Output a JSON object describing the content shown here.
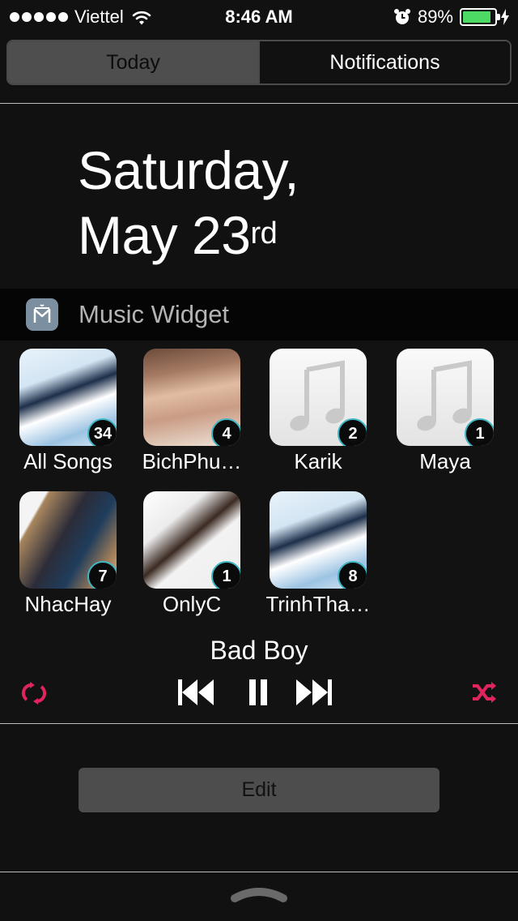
{
  "status_bar": {
    "carrier": "Viettel",
    "time": "8:46 AM",
    "battery": "89%",
    "battery_level": 0.89,
    "icons": [
      "signal-dots-icon",
      "wifi-icon",
      "alarm-icon",
      "battery-icon",
      "charging-bolt-icon"
    ]
  },
  "tabs": [
    {
      "label": "Today",
      "selected": true
    },
    {
      "label": "Notifications",
      "selected": false
    }
  ],
  "date": {
    "line1": "Saturday,",
    "line2": "May 23",
    "suffix": "rd"
  },
  "widget": {
    "title": "Music Widget",
    "icon": "music-widget-app-icon",
    "albums": [
      {
        "label": "All Songs",
        "count": "34",
        "cover": "photo-artwork"
      },
      {
        "label": "BichPhu…",
        "count": "4",
        "cover": "photo-artwork"
      },
      {
        "label": "Karik",
        "count": "2",
        "cover": "music-note-placeholder"
      },
      {
        "label": "Maya",
        "count": "1",
        "cover": "music-note-placeholder"
      },
      {
        "label": "NhacHay",
        "count": "7",
        "cover": "photo-artwork"
      },
      {
        "label": "OnlyC",
        "count": "1",
        "cover": "photo-artwork"
      },
      {
        "label": "TrinhTha…",
        "count": "8",
        "cover": "photo-artwork"
      }
    ],
    "now_playing": "Bad Boy",
    "controls": [
      "repeat-icon",
      "previous-track-icon",
      "pause-icon",
      "next-track-icon",
      "shuffle-icon"
    ],
    "accent_color": "#e0245e",
    "badge_ring_color": "#3fb7c4"
  },
  "edit_label": "Edit"
}
